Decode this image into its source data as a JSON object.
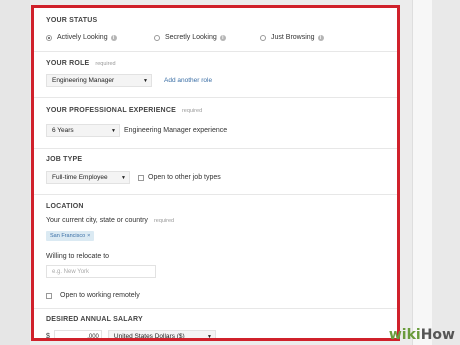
{
  "status": {
    "heading": "YOUR STATUS",
    "options": [
      {
        "label": "Actively Looking",
        "selected": true
      },
      {
        "label": "Secretly Looking",
        "selected": false
      },
      {
        "label": "Just Browsing",
        "selected": false
      }
    ]
  },
  "role": {
    "heading": "YOUR ROLE",
    "required": "required",
    "selected": "Engineering Manager",
    "add_link": "Add another role"
  },
  "experience": {
    "heading": "YOUR PROFESSIONAL EXPERIENCE",
    "required": "required",
    "selected": "6 Years",
    "suffix": "Engineering Manager experience"
  },
  "job_type": {
    "heading": "JOB TYPE",
    "selected": "Full-time Employee",
    "other_label": "Open to other job types"
  },
  "location": {
    "heading": "LOCATION",
    "current_label": "Your current city, state or country",
    "required": "required",
    "current_tag": "San Francisco",
    "tag_remove": "×",
    "relocate_label": "Willing to relocate to",
    "relocate_placeholder": "e.g. New York",
    "remote_label": "Open to working remotely"
  },
  "salary": {
    "heading": "DESIRED ANNUAL SALARY",
    "currency_symbol": "$",
    "amount_suffix": ",000",
    "currency": "United States Dollars ($)"
  },
  "watermark": {
    "wiki": "wiki",
    "how": "How"
  }
}
